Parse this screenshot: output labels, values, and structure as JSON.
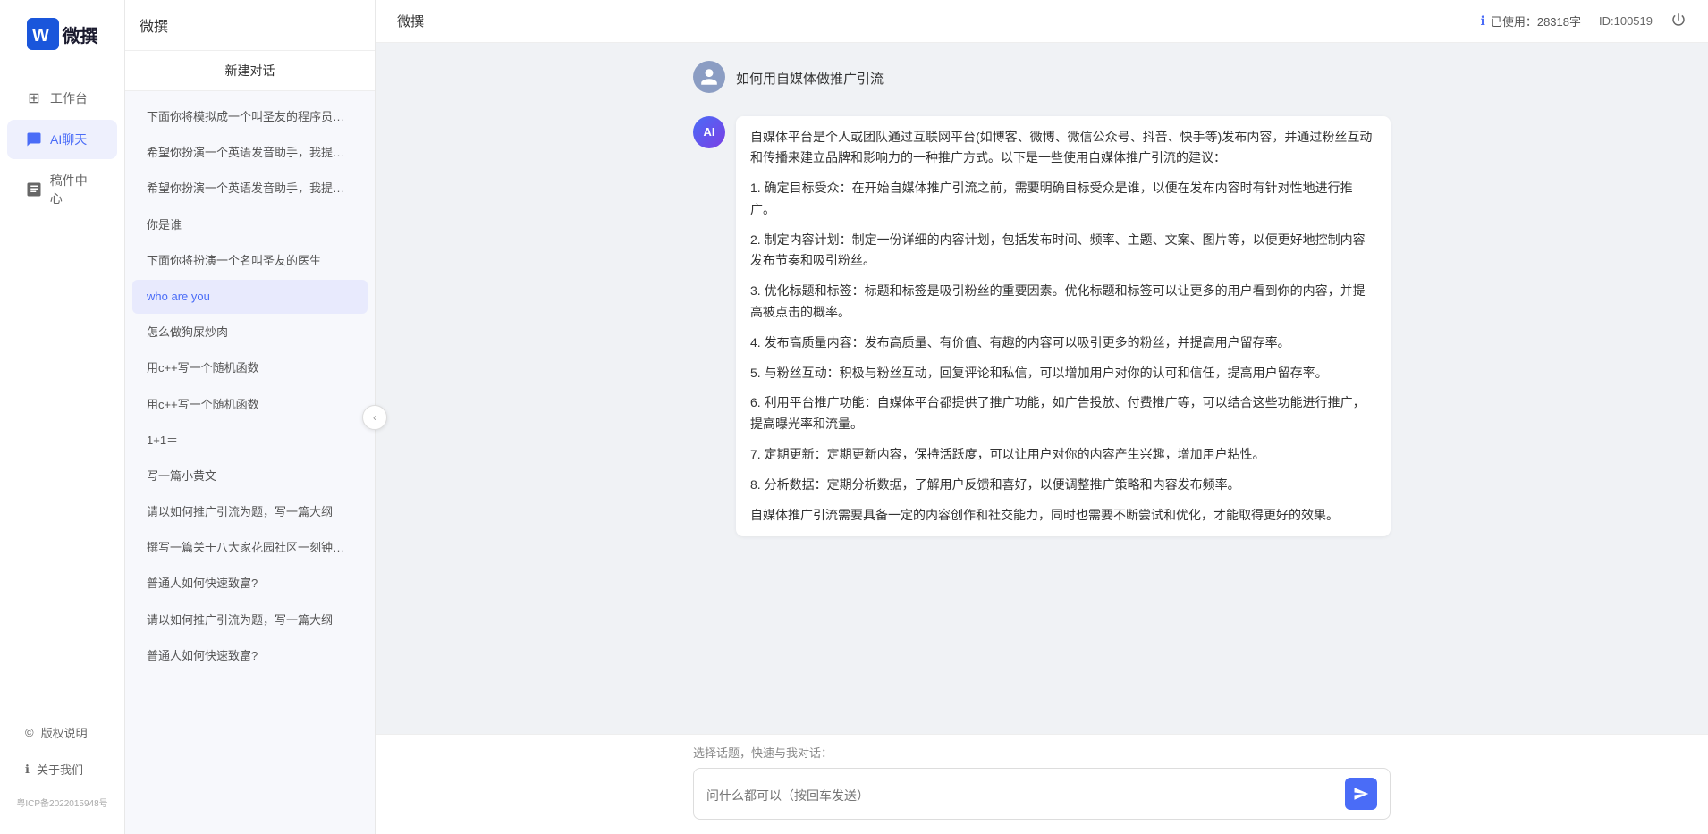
{
  "app": {
    "logo_text": "微撰",
    "title": "微撰",
    "usage_label": "已使用：28318字",
    "id_label": "ID:100519",
    "usage_icon": "ℹ"
  },
  "sidebar": {
    "nav_items": [
      {
        "id": "workbench",
        "label": "工作台",
        "icon": "⊞"
      },
      {
        "id": "ai-chat",
        "label": "AI聊天",
        "icon": "💬",
        "active": true
      },
      {
        "id": "drafts",
        "label": "稿件中心",
        "icon": "📄"
      }
    ],
    "bottom_items": [
      {
        "id": "copyright",
        "label": "版权说明",
        "icon": "©"
      },
      {
        "id": "about",
        "label": "关于我们",
        "icon": "ℹ"
      }
    ],
    "icp": "粤ICP备2022015948号"
  },
  "middle": {
    "title": "微撰",
    "new_chat": "新建对话",
    "chat_items": [
      "下面你将模拟成一个叫圣友的程序员，我说...",
      "希望你扮演一个英语发音助手，我提供给你...",
      "希望你扮演一个英语发音助手，我提供给你...",
      "你是谁",
      "下面你将扮演一个名叫圣友的医生",
      "who are you",
      "怎么做狗屎炒肉",
      "用c++写一个随机函数",
      "用c++写一个随机函数",
      "1+1＝",
      "写一篇小黄文",
      "请以如何推广引流为题，写一篇大纲",
      "撰写一篇关于八大家花园社区一刻钟便民生...",
      "普通人如何快速致富?",
      "请以如何推广引流为题，写一篇大纲",
      "普通人如何快速致富?"
    ],
    "active_chat_index": 5
  },
  "conversation": {
    "user_message": "如何用自媒体做推广引流",
    "ai_response": {
      "intro": "自媒体平台是个人或团队通过互联网平台(如博客、微博、微信公众号、抖音、快手等)发布内容，并通过粉丝互动和传播来建立品牌和影响力的一种推广方式。以下是一些使用自媒体推广引流的建议：",
      "points": [
        "1. 确定目标受众：在开始自媒体推广引流之前，需要明确目标受众是谁，以便在发布内容时有针对性地进行推广。",
        "2. 制定内容计划：制定一份详细的内容计划，包括发布时间、频率、主题、文案、图片等，以便更好地控制内容发布节奏和吸引粉丝。",
        "3. 优化标题和标签：标题和标签是吸引粉丝的重要因素。优化标题和标签可以让更多的用户看到你的内容，并提高被点击的概率。",
        "4. 发布高质量内容：发布高质量、有价值、有趣的内容可以吸引更多的粉丝，并提高用户留存率。",
        "5. 与粉丝互动：积极与粉丝互动，回复评论和私信，可以增加用户对你的认可和信任，提高用户留存率。",
        "6. 利用平台推广功能：自媒体平台都提供了推广功能，如广告投放、付费推广等，可以结合这些功能进行推广，提高曝光率和流量。",
        "7. 定期更新：定期更新内容，保持活跃度，可以让用户对你的内容产生兴趣，增加用户粘性。",
        "8. 分析数据：定期分析数据，了解用户反馈和喜好，以便调整推广策略和内容发布频率。"
      ],
      "conclusion": "自媒体推广引流需要具备一定的内容创作和社交能力，同时也需要不断尝试和优化，才能取得更好的效果。"
    }
  },
  "input": {
    "quick_topic_label": "选择话题，快速与我对话：",
    "placeholder": "问什么都可以（按回车发送）"
  },
  "colors": {
    "primary": "#4a6cf7",
    "ai_avatar_gradient_start": "#4a6cf7",
    "ai_avatar_gradient_end": "#7b3fe4"
  }
}
